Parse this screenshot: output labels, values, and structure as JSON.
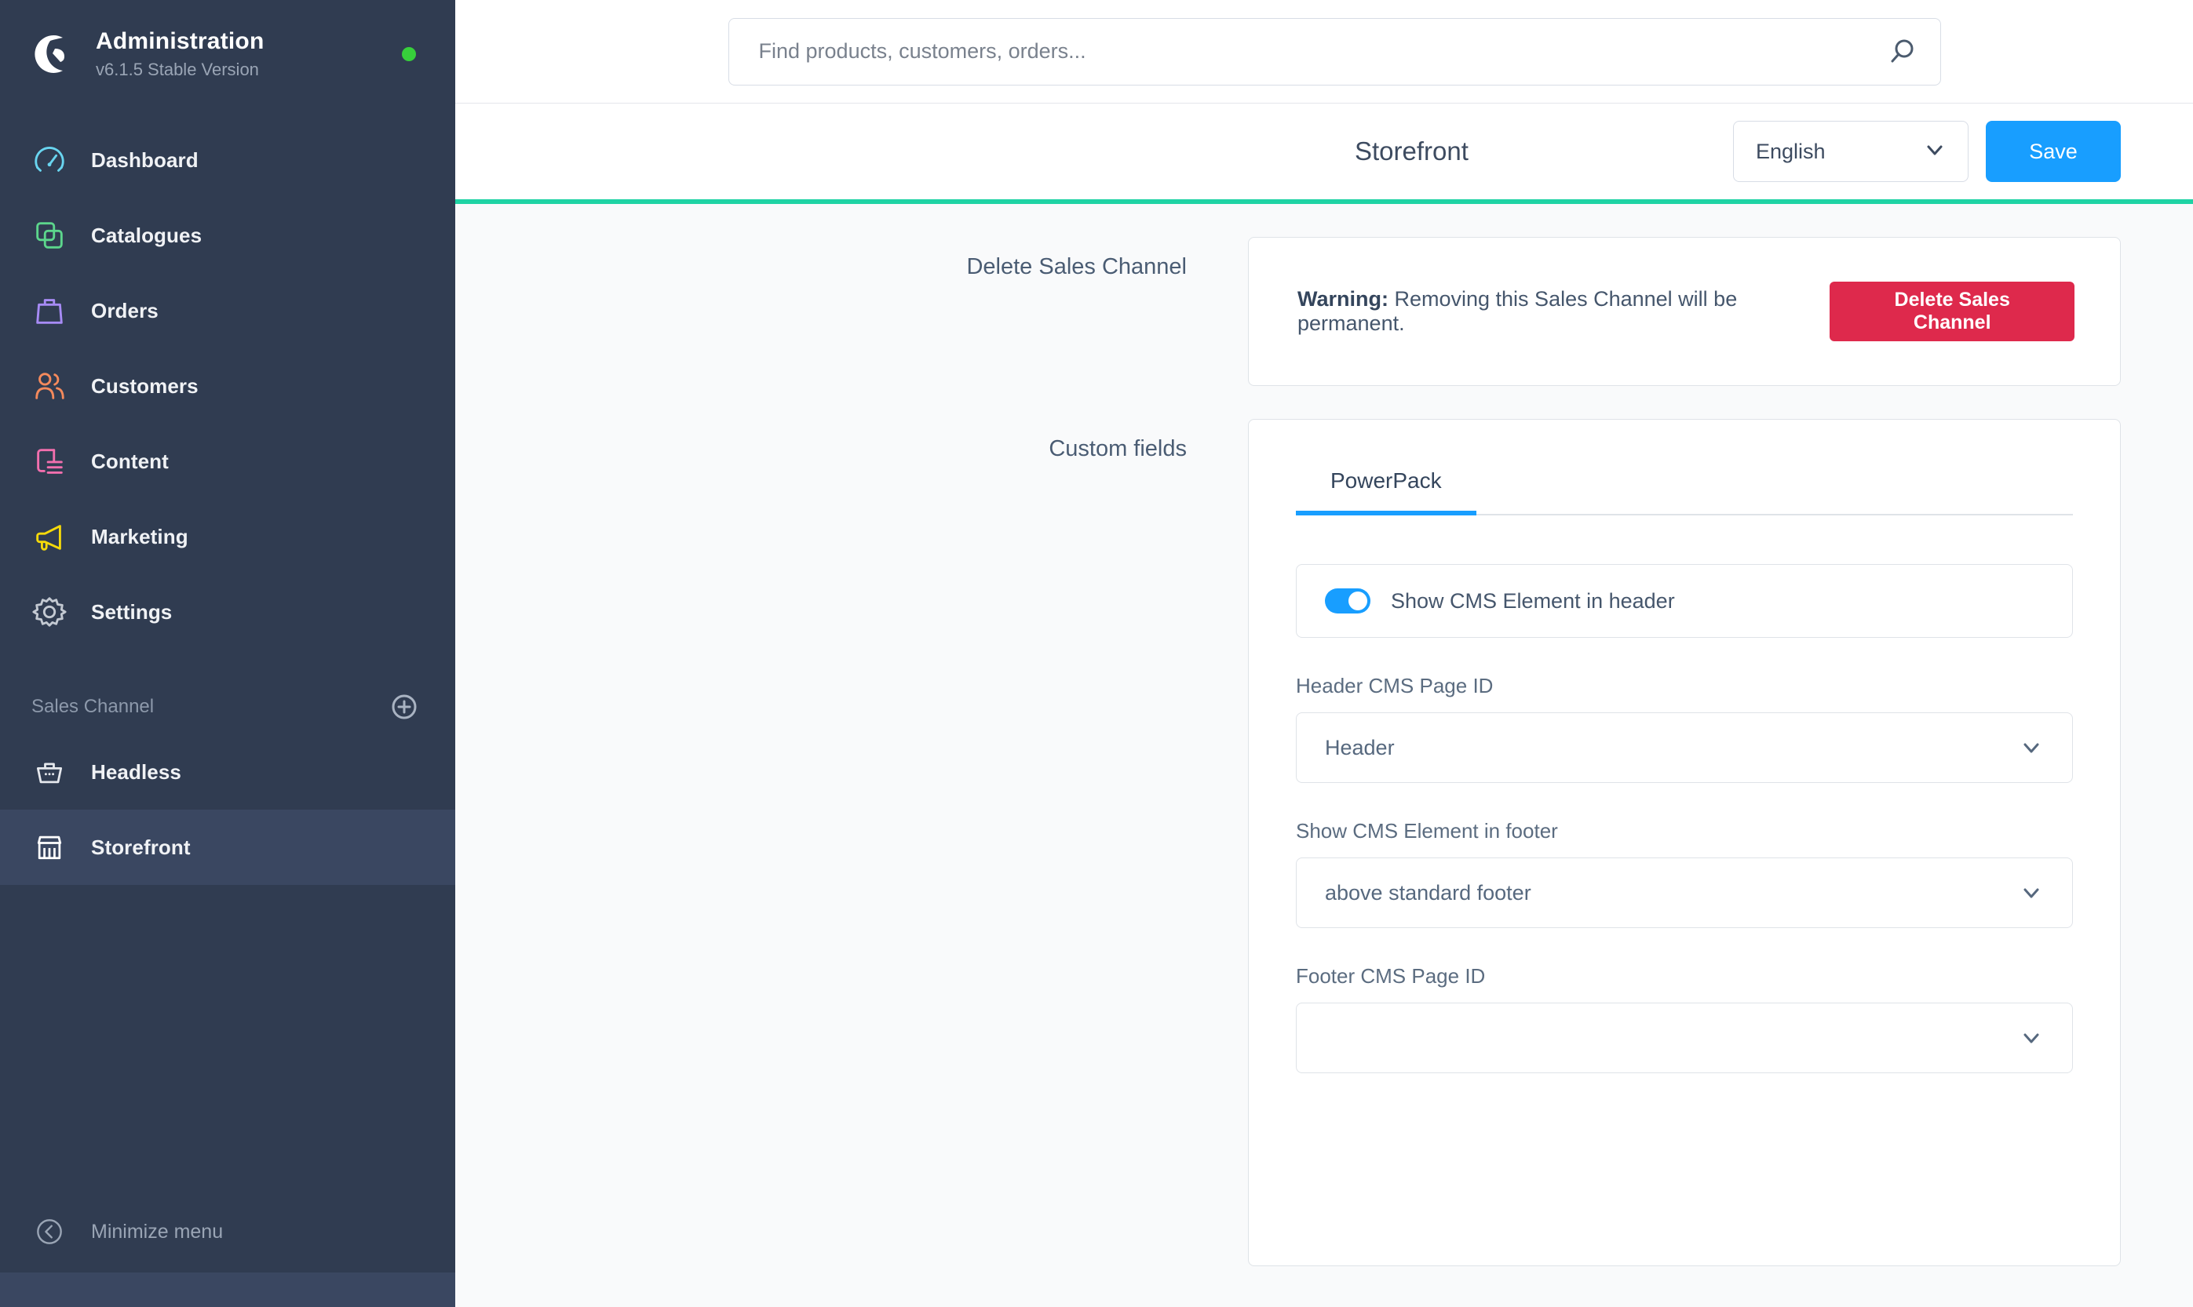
{
  "sidebar": {
    "brand": {
      "title": "Administration",
      "version": "v6.1.5 Stable Version",
      "status_color": "#37d03b"
    },
    "items": [
      {
        "label": "Dashboard",
        "icon": "gauge-icon",
        "color": "#69d5f0"
      },
      {
        "label": "Catalogues",
        "icon": "copy-icon",
        "color": "#5cd68c"
      },
      {
        "label": "Orders",
        "icon": "bag-icon",
        "color": "#a78bf5"
      },
      {
        "label": "Customers",
        "icon": "users-icon",
        "color": "#f58a5c"
      },
      {
        "label": "Content",
        "icon": "content-icon",
        "color": "#f26fae"
      },
      {
        "label": "Marketing",
        "icon": "megaphone-icon",
        "color": "#f5d90a"
      },
      {
        "label": "Settings",
        "icon": "gear-icon",
        "color": "#c3c9d2"
      }
    ],
    "sales_channel": {
      "heading": "Sales Channel",
      "add_icon": "plus-circle-icon",
      "items": [
        {
          "label": "Headless",
          "icon": "basket-icon",
          "active": false
        },
        {
          "label": "Storefront",
          "icon": "store-icon",
          "active": true
        }
      ]
    },
    "minimize": {
      "label": "Minimize menu",
      "icon": "chevron-left-circle-icon"
    }
  },
  "topbar": {
    "search": {
      "placeholder": "Find products, customers, orders...",
      "value": "",
      "icon": "search-icon"
    }
  },
  "pagehead": {
    "title": "Storefront",
    "language": {
      "value": "English",
      "icon": "chevron-down-icon"
    },
    "save_label": "Save",
    "accent_color": "#1fd3a4"
  },
  "delete_section": {
    "label": "Delete Sales Channel",
    "warning_prefix": "Warning:",
    "warning_text": " Removing this Sales Channel will be permanent.",
    "button_label": "Delete Sales Channel",
    "button_color": "#de294c"
  },
  "custom_fields": {
    "label": "Custom fields",
    "tabs": [
      {
        "label": "PowerPack",
        "active": true
      }
    ],
    "toggle": {
      "label": "Show CMS Element in header",
      "on": true,
      "color": "#189eff"
    },
    "fields": [
      {
        "label": "Header CMS Page ID",
        "value": "Header",
        "icon": "chevron-down-icon"
      },
      {
        "label": "Show CMS Element in footer",
        "value": "above standard footer",
        "icon": "chevron-down-icon"
      },
      {
        "label": "Footer CMS Page ID",
        "value": "",
        "icon": "chevron-down-icon"
      }
    ]
  }
}
